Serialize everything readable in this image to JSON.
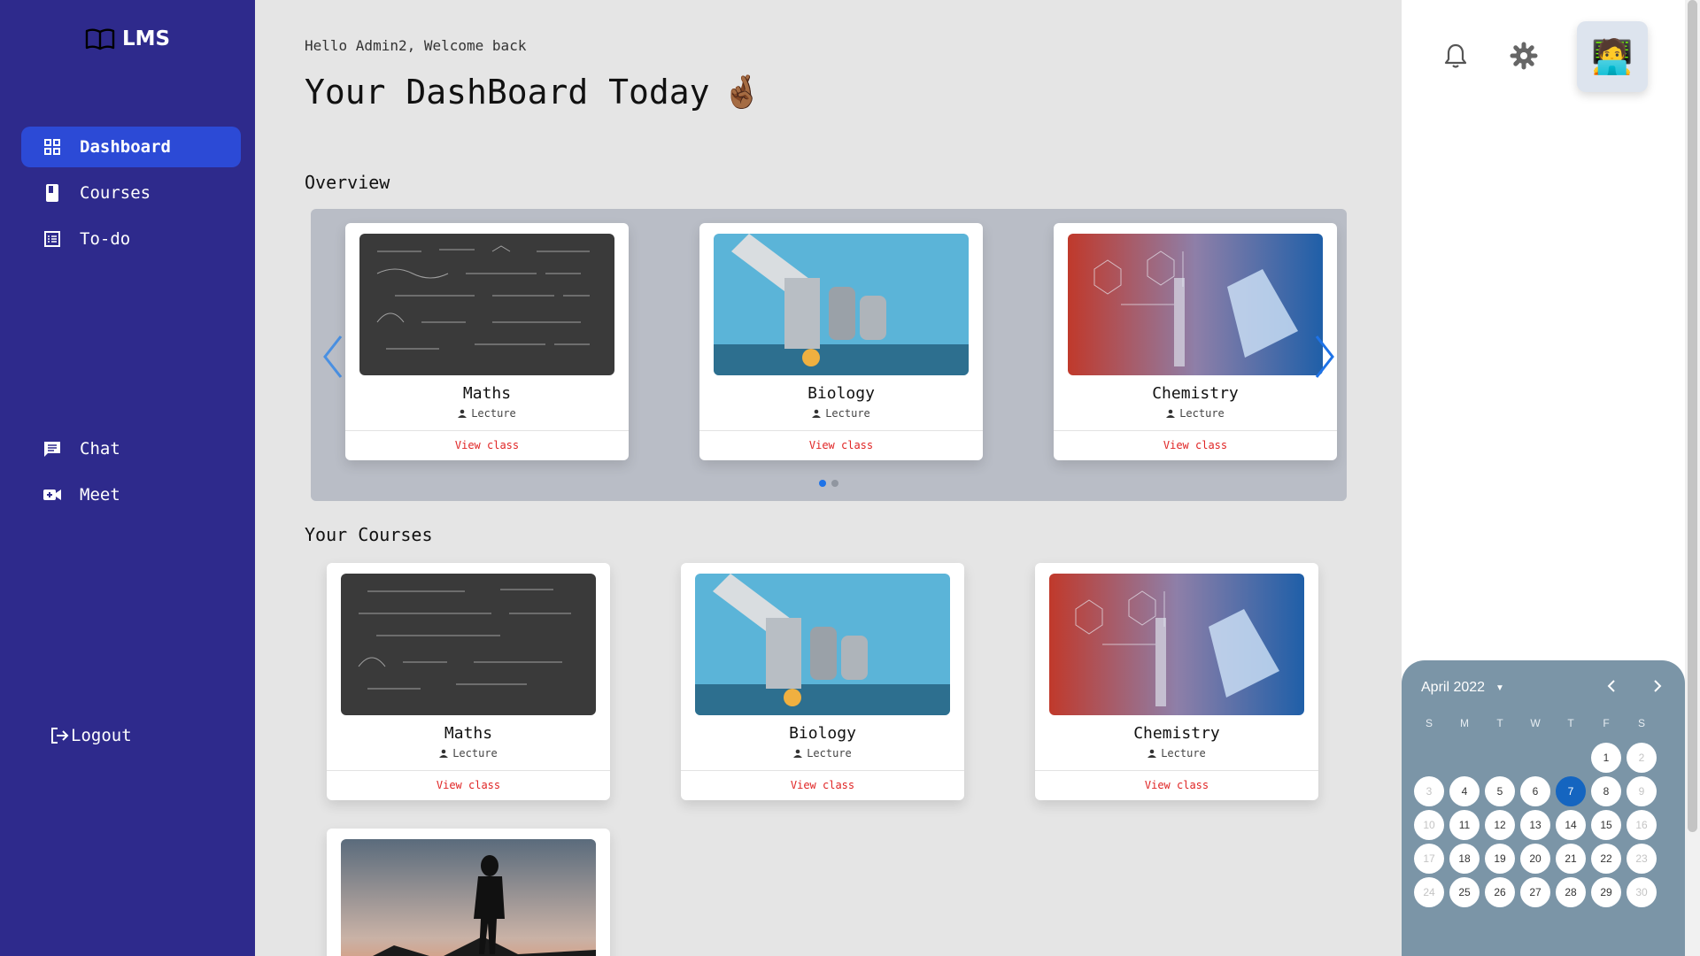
{
  "app": {
    "logo_text": "LMS"
  },
  "sidebar": {
    "items": [
      {
        "label": "Dashboard",
        "icon": "grid-icon"
      },
      {
        "label": "Courses",
        "icon": "book-icon"
      },
      {
        "label": "To-do",
        "icon": "list-icon"
      },
      {
        "label": "Chat",
        "icon": "chat-icon"
      },
      {
        "label": "Meet",
        "icon": "video-icon"
      }
    ],
    "logout": "Logout"
  },
  "main": {
    "greeting": "Hello Admin2, Welcome back",
    "title": "Your DashBoard Today",
    "title_emoji": "🤞🏾",
    "overview_title": "Overview",
    "courses_title": "Your Courses"
  },
  "overview_cards": [
    {
      "name": "Maths",
      "sub": "Lecture",
      "action": "View class",
      "image": "chalkboard"
    },
    {
      "name": "Biology",
      "sub": "Lecture",
      "action": "View class",
      "image": "microscope"
    },
    {
      "name": "Chemistry",
      "sub": "Lecture",
      "action": "View class",
      "image": "lab-flask"
    }
  ],
  "course_cards": [
    {
      "name": "Maths",
      "sub": "Lecture",
      "action": "View class",
      "image": "chalkboard"
    },
    {
      "name": "Biology",
      "sub": "Lecture",
      "action": "View class",
      "image": "microscope"
    },
    {
      "name": "Chemistry",
      "sub": "Lecture",
      "action": "View class",
      "image": "lab-flask"
    },
    {
      "image": "mountain-silhouette"
    }
  ],
  "carousel": {
    "pages": 2,
    "active_page": 1
  },
  "topbar": {
    "avatar_emoji": "🧑‍💻"
  },
  "calendar": {
    "month_label": "April 2022",
    "weekdays": [
      "S",
      "M",
      "T",
      "W",
      "T",
      "F",
      "S"
    ],
    "days": [
      {
        "d": "1",
        "faded": false
      },
      {
        "d": "2",
        "faded": true
      },
      {
        "d": "3",
        "faded": true
      },
      {
        "d": "4",
        "faded": false
      },
      {
        "d": "5",
        "faded": false
      },
      {
        "d": "6",
        "faded": false
      },
      {
        "d": "7",
        "faded": false,
        "today": true
      },
      {
        "d": "8",
        "faded": false
      },
      {
        "d": "9",
        "faded": true
      },
      {
        "d": "10",
        "faded": true
      },
      {
        "d": "11",
        "faded": false
      },
      {
        "d": "12",
        "faded": false
      },
      {
        "d": "13",
        "faded": false
      },
      {
        "d": "14",
        "faded": false
      },
      {
        "d": "15",
        "faded": false
      },
      {
        "d": "16",
        "faded": true
      },
      {
        "d": "17",
        "faded": true
      },
      {
        "d": "18",
        "faded": false
      },
      {
        "d": "19",
        "faded": false
      },
      {
        "d": "20",
        "faded": false
      },
      {
        "d": "21",
        "faded": false
      },
      {
        "d": "22",
        "faded": false
      },
      {
        "d": "23",
        "faded": true
      },
      {
        "d": "24",
        "faded": true
      },
      {
        "d": "25",
        "faded": false
      },
      {
        "d": "26",
        "faded": false
      },
      {
        "d": "27",
        "faded": false
      },
      {
        "d": "28",
        "faded": false
      },
      {
        "d": "29",
        "faded": false
      },
      {
        "d": "30",
        "faded": true
      }
    ],
    "first_weekday": 5,
    "today_color": "#1565c0"
  },
  "colors": {
    "sidebar": "#2e2a8c",
    "active_nav": "#2c4ad6",
    "link": "#e02424",
    "calendar_bg": "#7b95a7"
  }
}
